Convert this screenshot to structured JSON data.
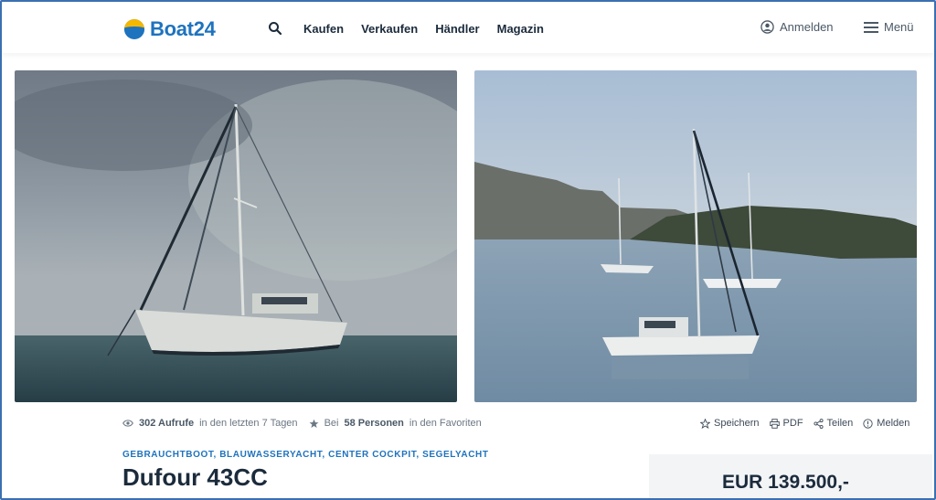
{
  "brand": {
    "name": "Boat24",
    "primary_color": "#1e73be",
    "accent_color": "#f5b800"
  },
  "header": {
    "search_icon": "search-icon",
    "nav": [
      "Kaufen",
      "Verkaufen",
      "Händler",
      "Magazin"
    ],
    "login_label": "Anmelden",
    "menu_label": "Menü"
  },
  "gallery": {
    "photo_1": "sailboat-on-cloudy-sea",
    "photo_2": "sailboats-anchored-in-bay"
  },
  "stats": {
    "views_count": "302 Aufrufe",
    "views_suffix": "in den letzten 7 Tagen",
    "favorites_prefix": "Bei",
    "favorites_count": "58 Personen",
    "favorites_suffix": "in den Favoriten"
  },
  "actions": {
    "save": "Speichern",
    "pdf": "PDF",
    "share": "Teilen",
    "report": "Melden"
  },
  "listing": {
    "category": "GEBRAUCHTBOOT, BLAUWASSERYACHT, CENTER COCKPIT, SEGELYACHT",
    "title": "Dufour 43CC",
    "price": "EUR 139.500,-"
  }
}
